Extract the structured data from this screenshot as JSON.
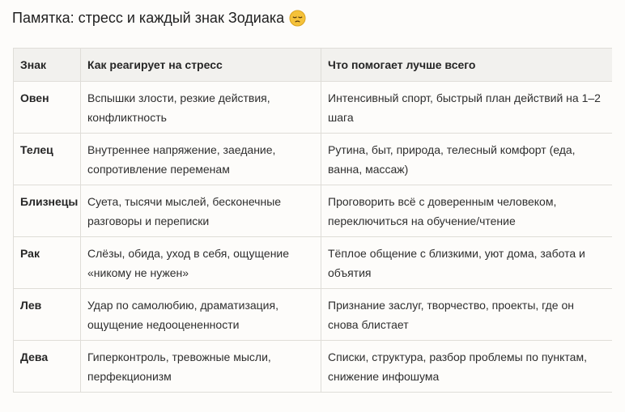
{
  "title": "Памятка: стресс и каждый знак Зодиака",
  "title_emoji": "pensive-face-emoji",
  "colors": {
    "background": "#fdfcfa",
    "header_bg": "#f2f1ee",
    "border": "#dfddd8",
    "emoji": "#f5c23a"
  },
  "table": {
    "headers": [
      "Знак",
      "Как реагирует на стресс",
      "Что помогает лучше всего"
    ],
    "rows": [
      {
        "sign": "Овен",
        "reaction": "Вспышки злости, резкие действия, конфликтность",
        "help": "Интенсивный спорт, быстрый план действий на 1–2 шага"
      },
      {
        "sign": "Телец",
        "reaction": "Внутреннее напряжение, заедание, сопротивление переменам",
        "help": "Рутина, быт, природа, телесный комфорт (еда, ванна, массаж)"
      },
      {
        "sign": "Близнецы",
        "reaction": "Суета, тысячи мыслей, бесконечные разговоры и переписки",
        "help": "Проговорить всё с доверенным человеком, переключиться на обучение/чтение"
      },
      {
        "sign": "Рак",
        "reaction": "Слёзы, обида, уход в себя, ощущение «никому не нужен»",
        "help": "Тёплое общение с близкими, уют дома, забота и объятия"
      },
      {
        "sign": "Лев",
        "reaction": "Удар по самолюбию, драматизация, ощущение недооцененности",
        "help": "Признание заслуг, творчество, проекты, где он снова блистает"
      },
      {
        "sign": "Дева",
        "reaction": "Гиперконтроль, тревожные мысли, перфекционизм",
        "help": "Списки, структура, разбор проблемы по пунктам, снижение инфошума"
      }
    ]
  }
}
